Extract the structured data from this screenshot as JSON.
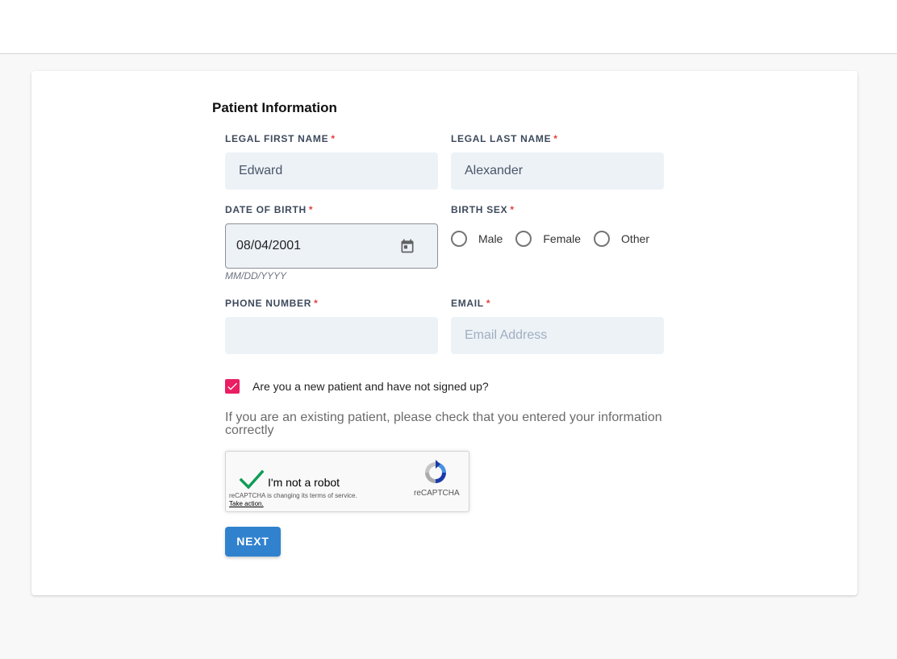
{
  "form": {
    "title": "Patient Information",
    "first_name": {
      "label": "LEGAL FIRST NAME",
      "required": "*",
      "value": "Edward"
    },
    "last_name": {
      "label": "LEGAL LAST NAME",
      "required": "*",
      "value": "Alexander"
    },
    "dob": {
      "label": "DATE OF BIRTH",
      "required": "*",
      "value": "08/04/2001",
      "hint": "MM/DD/YYYY",
      "icon": "calendar-icon"
    },
    "sex": {
      "label": "BIRTH SEX",
      "required": "*",
      "options": [
        "Male",
        "Female",
        "Other"
      ]
    },
    "phone": {
      "label": "PHONE NUMBER",
      "required": "*",
      "value": ""
    },
    "email": {
      "label": "EMAIL",
      "required": "*",
      "placeholder": "Email Address"
    },
    "new_patient": {
      "label": "Are you a new patient and have not signed up?",
      "checked": true
    },
    "info_text": "If you are an existing patient, please check that you entered your information correctly",
    "recaptcha": {
      "label": "I'm not a robot",
      "terms": "reCAPTCHA is changing its terms of service.",
      "action": "Take action.",
      "brand": "reCAPTCHA"
    },
    "next_label": "NEXT"
  },
  "colors": {
    "accent": "#3182ce",
    "checkbox": "#e91e63",
    "required": "#e53e3e",
    "input_bg": "#edf2f7"
  }
}
